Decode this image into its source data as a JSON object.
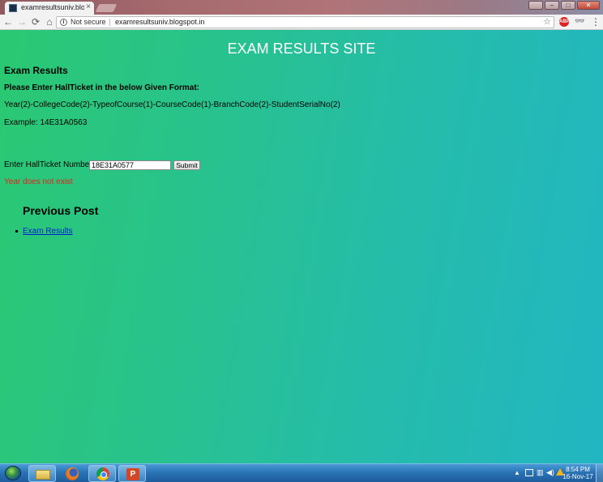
{
  "browser": {
    "tab": {
      "title": "examresultsuniv.blogspot",
      "close": "×"
    },
    "nav": {
      "back": "←",
      "forward": "→",
      "reload": "⟳",
      "home": "⌂"
    },
    "address": {
      "security_label": "Not secure",
      "url": "examresultsuniv.blogspot.in"
    },
    "extensions": {
      "abp": "ABP"
    }
  },
  "page": {
    "site_title": "EXAM RESULTS SITE",
    "heading": "Exam Results",
    "format_prompt": "Please Enter HallTicket in the below Given Format:",
    "format_pattern": "Year(2)-CollegeCode(2)-TypeofCourse(1)-CourseCode(1)-BranchCode(2)-StudentSerialNo(2)",
    "example": "Example: 14E31A0563",
    "form": {
      "label": "Enter HallTicket Number:",
      "input_value": "18E31A0577",
      "submit_label": "Submit"
    },
    "error_message": "Year does not exist",
    "previous_post": {
      "heading": "Previous Post",
      "links": [
        "Exam Results"
      ]
    }
  },
  "taskbar": {
    "clock": {
      "time": "8:54 PM",
      "date": "16-Nov-17"
    },
    "apps": [
      "explorer",
      "firefox",
      "chrome",
      "powerpoint"
    ]
  },
  "colors": {
    "page_gradient_start": "#2bc872",
    "page_gradient_end": "#22b6c2",
    "error_text": "#e8201c",
    "link": "#0022cc"
  }
}
